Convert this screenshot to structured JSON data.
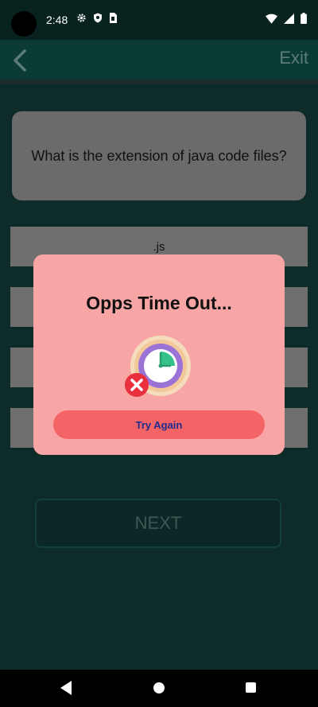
{
  "status_bar": {
    "time": "2:48",
    "icons_left": [
      "settings-gear",
      "shield",
      "sim-card"
    ],
    "icons_right": [
      "wifi",
      "cell-signal",
      "battery"
    ]
  },
  "app_bar": {
    "back_icon": "chevron-left",
    "exit_label": "Exit"
  },
  "quiz": {
    "question": "What is the extension of java code files?",
    "options": [
      ".js",
      "",
      "",
      ""
    ],
    "next_label": "NEXT"
  },
  "dialog": {
    "title": "Opps Time Out...",
    "illustration_icon": "clock-with-x",
    "button_label": "Try Again"
  },
  "colors": {
    "background": "#0c2b29",
    "app_bar": "#0a3b35",
    "card_grey": "#6b6b6b",
    "dialog_bg": "#f7a5a5",
    "dialog_button": "#f46467",
    "dialog_button_text": "#1d2c8f"
  }
}
